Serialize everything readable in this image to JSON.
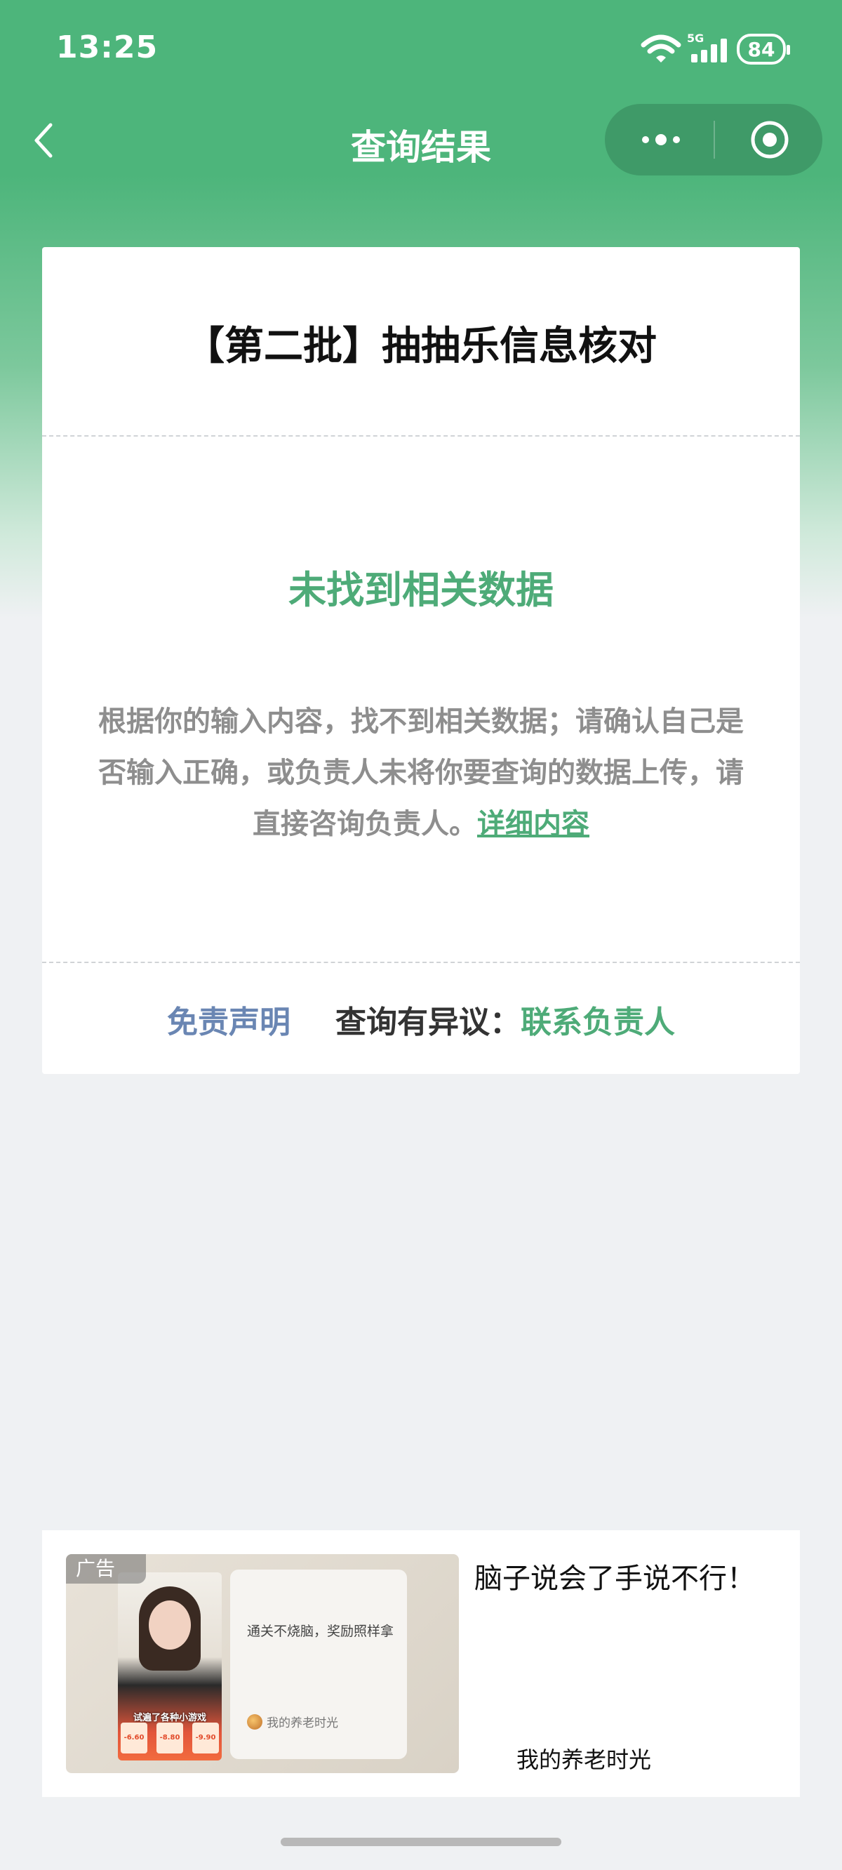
{
  "status_bar": {
    "time": "13:25",
    "network": "5G",
    "battery": "84"
  },
  "nav": {
    "title": "查询结果",
    "back_icon": "chevron-left-icon",
    "more_icon": "more-dots-icon",
    "close_icon": "target-circle-icon"
  },
  "card": {
    "title": "【第二批】抽抽乐信息核对",
    "result_title": "未找到相关数据",
    "description": "根据你的输入内容，找不到相关数据；请确认自己是否输入正确，或负责人未将你要查询的数据上传，请直接咨询负责人。",
    "detail_link": "详细内容",
    "disclaimer": "免责声明",
    "dispute_label": "查询有异议：",
    "contact_link": "联系负责人"
  },
  "ad": {
    "tag": "广告",
    "video_caption": "试遍了各种小游戏",
    "video_chips": [
      "-6.60",
      "-8.80",
      "-9.90"
    ],
    "overlay_text": "通关不烧脑，奖励照样拿",
    "overlay_brand": "我的养老时光",
    "headline": "脑子说会了手说不行！",
    "brand": "我的养老时光"
  },
  "colors": {
    "brand_green": "#4db57b",
    "accent_green": "#4eab78",
    "link_blue": "#6a86b3"
  }
}
